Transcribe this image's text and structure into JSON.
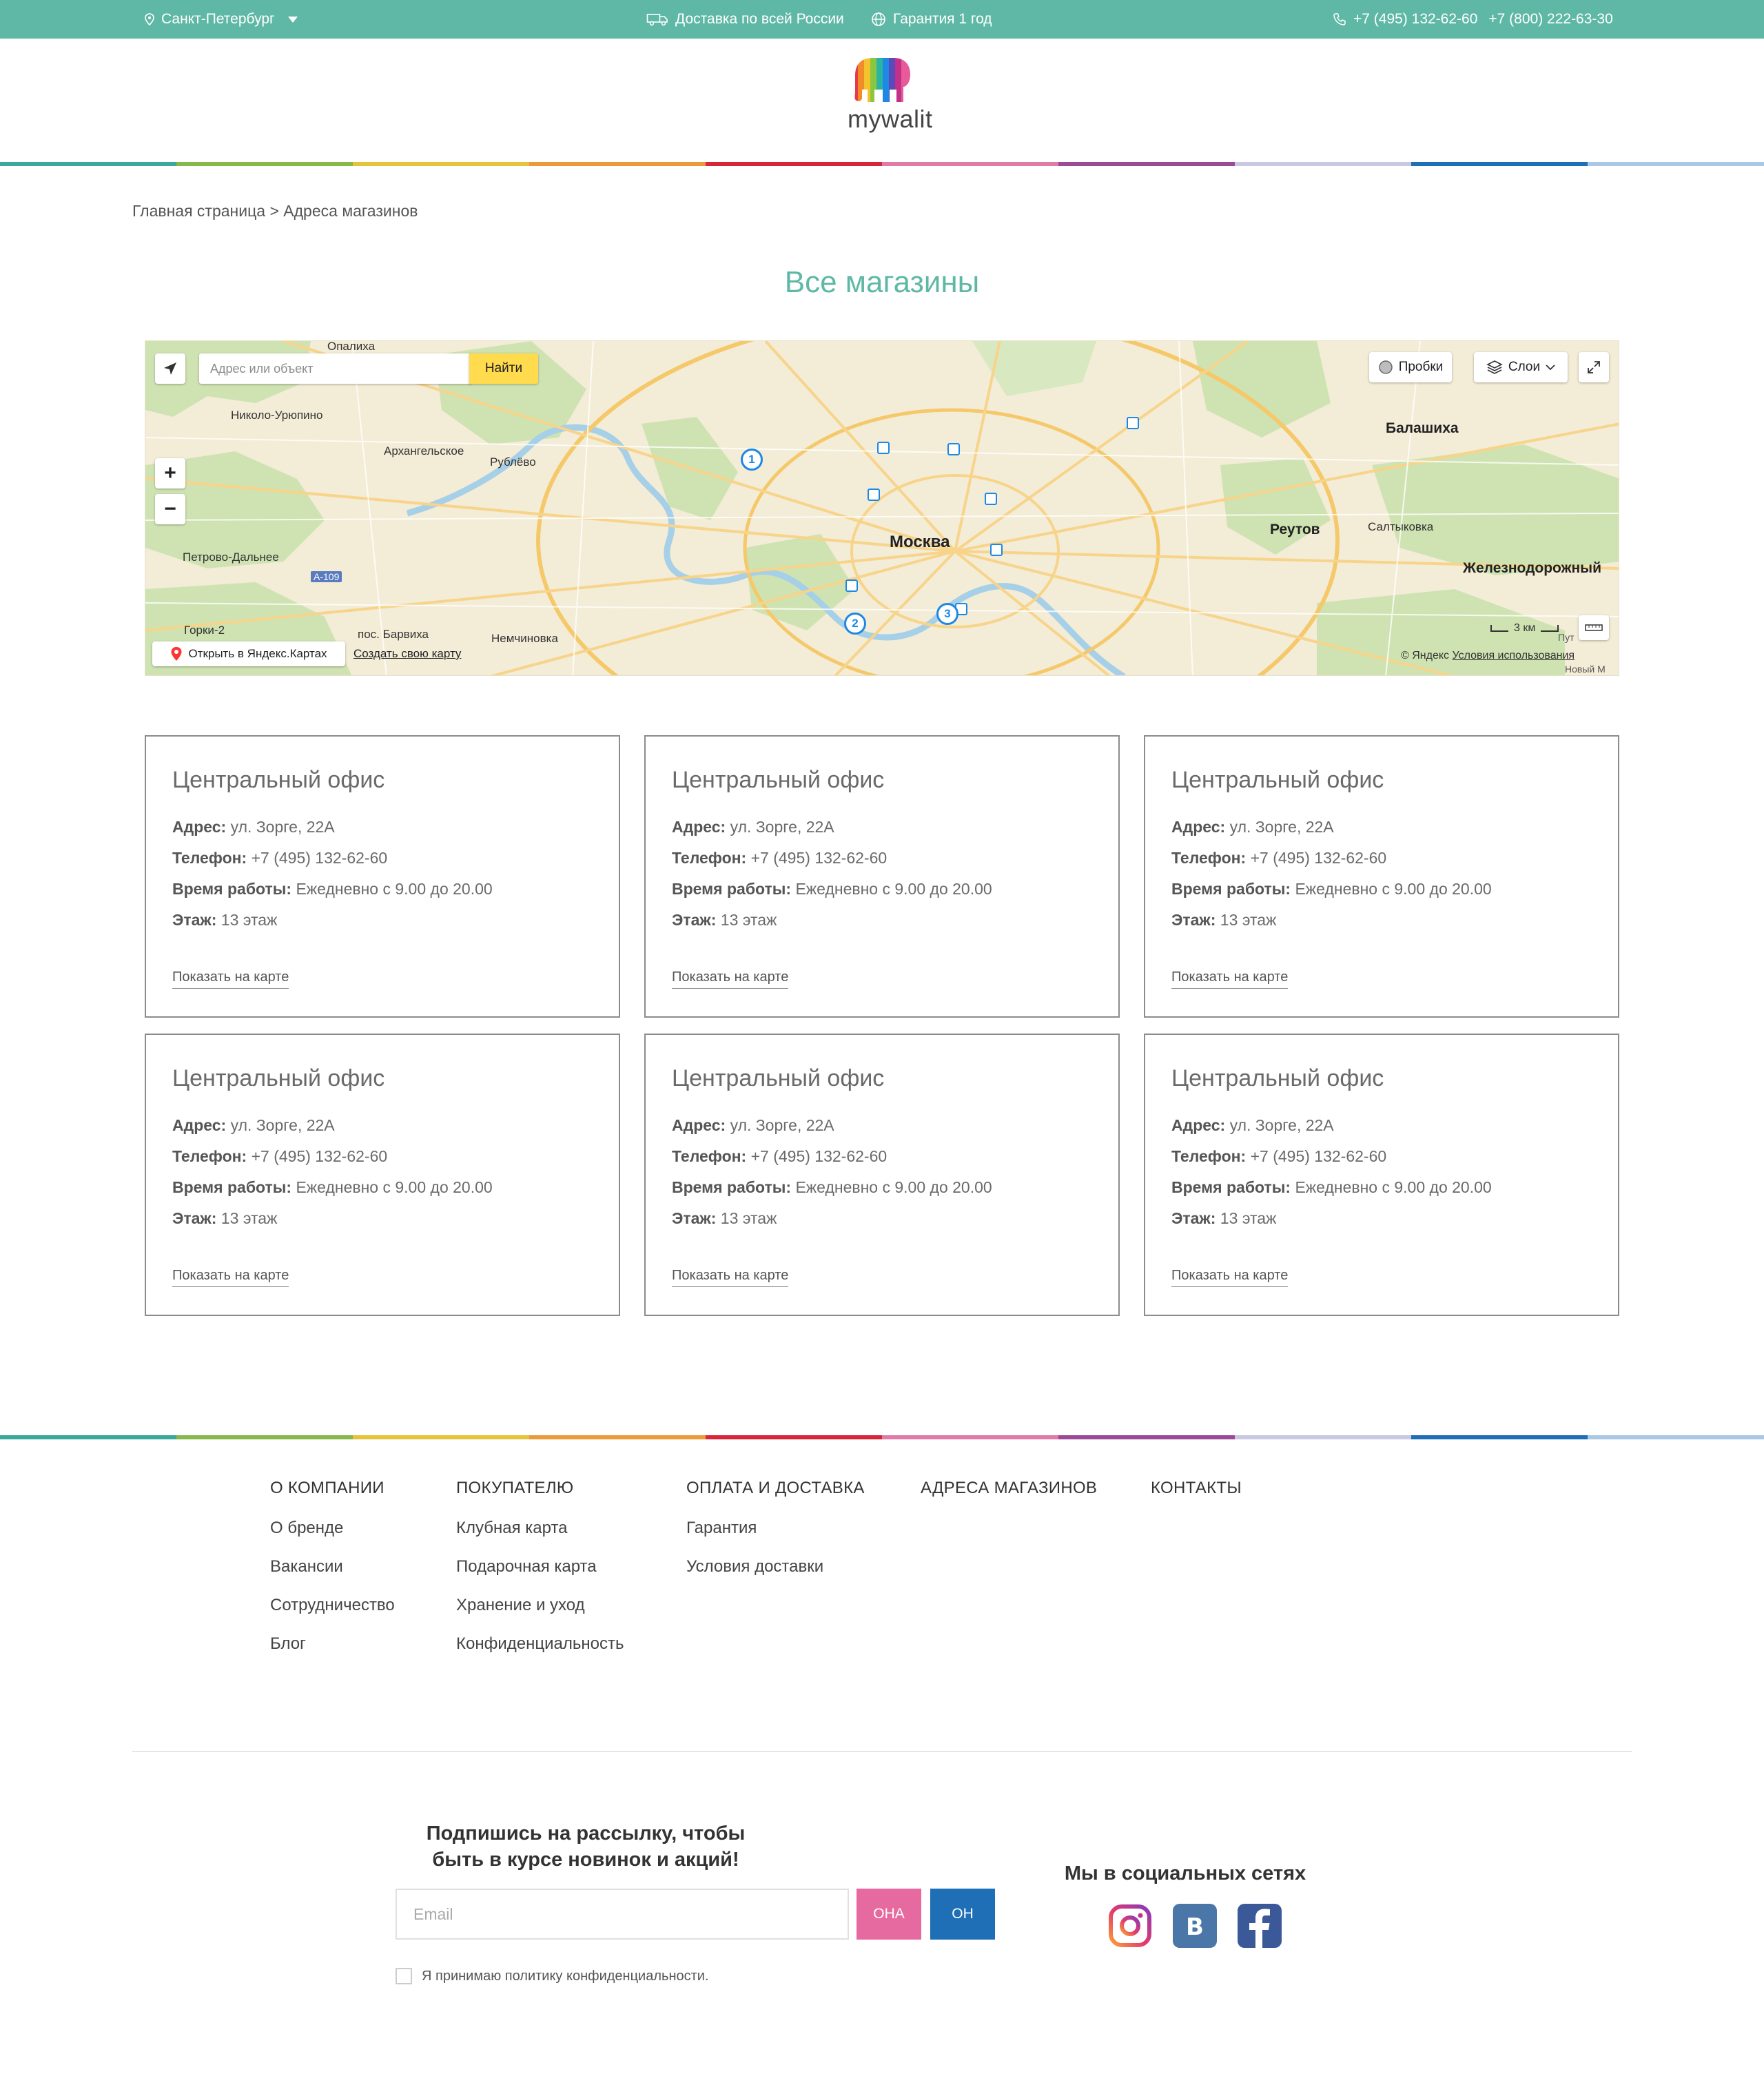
{
  "topbar": {
    "city": "Санкт-Петербург",
    "delivery": "Доставка по всей России",
    "warranty": "Гарантия 1 год",
    "phone1": "+7 (495) 132-62-60",
    "phone2": "+7 (800) 222-63-30",
    "icons": [
      "location-pin-icon",
      "chevron-down-icon",
      "truck-icon",
      "globe-icon",
      "phone-icon"
    ]
  },
  "header": {
    "logo_text": "mywalit"
  },
  "breadcrumb": {
    "home": "Главная страница",
    "separator": ">",
    "current": "Адреса магазинов"
  },
  "page": {
    "title": "Все магазины"
  },
  "map": {
    "search_placeholder": "Адрес или объект",
    "find_button": "Найти",
    "traffic": "Пробки",
    "layers": "Слои",
    "zoom_in": "+",
    "zoom_out": "−",
    "open_in_yandex": "Открыть в Яндекс.Картах",
    "create_map": "Создать свою карту",
    "scale": "3 км",
    "copyright": "© Яндекс",
    "terms": "Условия использования",
    "labels": {
      "moscow": "Москва",
      "balashikha": "Балашиха",
      "reutov": "Реутов",
      "zheleznodorozhny": "Железнодорожный",
      "saltykovka": "Салтыковка",
      "nikolo_uryupino": "Николо-Урюпино",
      "arkhangelskoe": "Архангельское",
      "rublevo": "Рублёво",
      "petrovo_dalnee": "Петрово-Дальнее",
      "gorki2": "Горки-2",
      "barvikha": "пос. Барвиха",
      "nemchinovka": "Немчиновка",
      "opalikha": "Опалиха",
      "a109": "A-109",
      "put": "Пут",
      "novy": "Новый М"
    },
    "pins": [
      "1",
      "2",
      "3"
    ]
  },
  "stores": [
    {
      "title": "Центральный офис",
      "address_label": "Адрес:",
      "address": "ул. Зорге, 22А",
      "phone_label": "Телефон:",
      "phone": "+7 (495) 132-62-60",
      "hours_label": "Время работы:",
      "hours": "Ежедневно с 9.00 до 20.00",
      "floor_label": "Этаж:",
      "floor": "13 этаж",
      "link": "Показать на карте"
    },
    {
      "title": "Центральный офис",
      "address_label": "Адрес:",
      "address": "ул. Зорге, 22А",
      "phone_label": "Телефон:",
      "phone": "+7 (495) 132-62-60",
      "hours_label": "Время работы:",
      "hours": "Ежедневно с 9.00 до 20.00",
      "floor_label": "Этаж:",
      "floor": "13 этаж",
      "link": "Показать на карте"
    },
    {
      "title": "Центральный офис",
      "address_label": "Адрес:",
      "address": "ул. Зорге, 22А",
      "phone_label": "Телефон:",
      "phone": "+7 (495) 132-62-60",
      "hours_label": "Время работы:",
      "hours": "Ежедневно с 9.00 до 20.00",
      "floor_label": "Этаж:",
      "floor": "13 этаж",
      "link": "Показать на карте"
    },
    {
      "title": "Центральный офис",
      "address_label": "Адрес:",
      "address": "ул. Зорге, 22А",
      "phone_label": "Телефон:",
      "phone": "+7 (495) 132-62-60",
      "hours_label": "Время работы:",
      "hours": "Ежедневно с 9.00 до 20.00",
      "floor_label": "Этаж:",
      "floor": "13 этаж",
      "link": "Показать на карте"
    },
    {
      "title": "Центральный офис",
      "address_label": "Адрес:",
      "address": "ул. Зорге, 22А",
      "phone_label": "Телефон:",
      "phone": "+7 (495) 132-62-60",
      "hours_label": "Время работы:",
      "hours": "Ежедневно с 9.00 до 20.00",
      "floor_label": "Этаж:",
      "floor": "13 этаж",
      "link": "Показать на карте"
    },
    {
      "title": "Центральный офис",
      "address_label": "Адрес:",
      "address": "ул. Зорге, 22А",
      "phone_label": "Телефон:",
      "phone": "+7 (495) 132-62-60",
      "hours_label": "Время работы:",
      "hours": "Ежедневно с 9.00 до 20.00",
      "floor_label": "Этаж:",
      "floor": "13 этаж",
      "link": "Показать на карте"
    }
  ],
  "footer": {
    "columns": [
      {
        "title": "О КОМПАНИИ",
        "links": [
          "О бренде",
          "Вакансии",
          "Сотрудничество",
          "Блог"
        ]
      },
      {
        "title": "ПОКУПАТЕЛЮ",
        "links": [
          "Клубная карта",
          "Подарочная карта",
          "Хранение и уход",
          "Конфиденциальность"
        ]
      },
      {
        "title": "ОПЛАТА И ДОСТАВКА",
        "links": [
          "Гарантия",
          "Условия доставки"
        ]
      },
      {
        "title": "АДРЕСА МАГАЗИНОВ",
        "links": []
      },
      {
        "title": "КОНТАКТЫ",
        "links": []
      }
    ],
    "subscribe": {
      "title_line1": "Подпишись на рассылку, чтобы",
      "title_line2": "быть в курсе новинок и акций!",
      "email_placeholder": "Email",
      "btn_she": "ОНА",
      "btn_he": "ОН",
      "agree": "Я принимаю политику конфиденциальности."
    },
    "social": {
      "title": "Мы в социальных сетях",
      "icons": [
        "instagram-icon",
        "vk-icon",
        "facebook-icon"
      ]
    }
  },
  "colors": {
    "accent": "#5fb8a5",
    "btn_she": "#e66aa0",
    "btn_he": "#1e6fb5",
    "rainbow": [
      "#3aa89a",
      "#86b84a",
      "#e3c43b",
      "#eb9a3a",
      "#d6263a",
      "#e07aa7",
      "#9a4a97",
      "#c8c8e0",
      "#1e6fb5",
      "#a8c8e6"
    ]
  }
}
